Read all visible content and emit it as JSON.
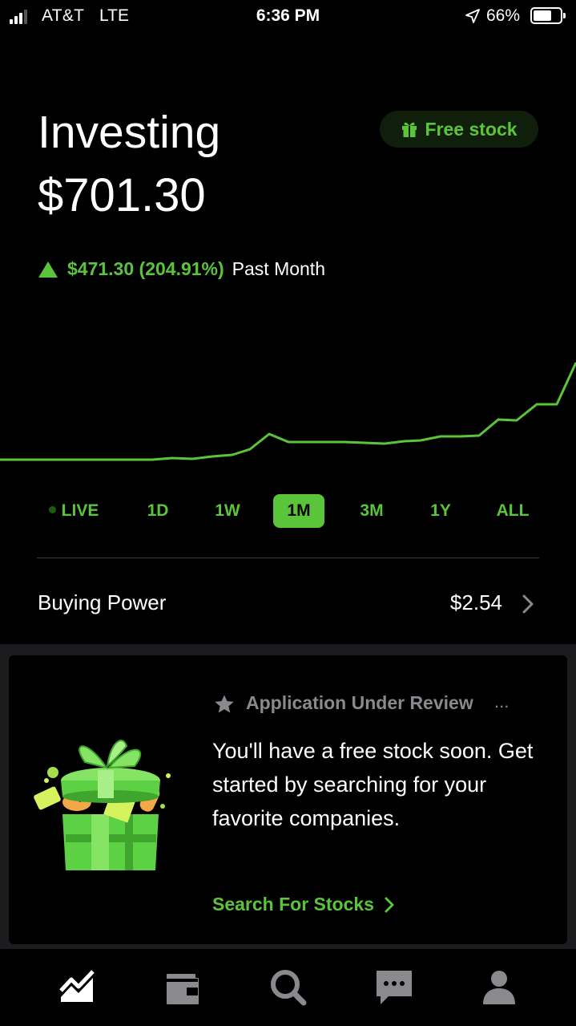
{
  "status_bar": {
    "carrier": "AT&T",
    "network": "LTE",
    "time": "6:36 PM",
    "battery": "66%"
  },
  "header": {
    "title": "Investing",
    "free_stock_label": "Free stock",
    "balance": "$701.30",
    "change_amount": "$471.30 (204.91%)",
    "change_period": "Past Month"
  },
  "ranges": [
    {
      "label": "LIVE",
      "active": false
    },
    {
      "label": "1D",
      "active": false
    },
    {
      "label": "1W",
      "active": false
    },
    {
      "label": "1M",
      "active": true
    },
    {
      "label": "3M",
      "active": false
    },
    {
      "label": "1Y",
      "active": false
    },
    {
      "label": "ALL",
      "active": false
    }
  ],
  "buying_power": {
    "label": "Buying Power",
    "value": "$2.54"
  },
  "card": {
    "status": "Application Under Review",
    "more": "...",
    "body": "You'll have a free stock soon. Get started by searching for your favorite companies.",
    "link": "Search For Stocks"
  },
  "tabs": [
    {
      "icon": "chart-icon",
      "active": true
    },
    {
      "icon": "wallet-icon",
      "active": false
    },
    {
      "icon": "search-icon",
      "active": false
    },
    {
      "icon": "messages-icon",
      "active": false
    },
    {
      "icon": "account-icon",
      "active": false
    }
  ],
  "colors": {
    "accent": "#5ac53b",
    "background": "#000000",
    "muted": "#8a8a8e"
  }
}
